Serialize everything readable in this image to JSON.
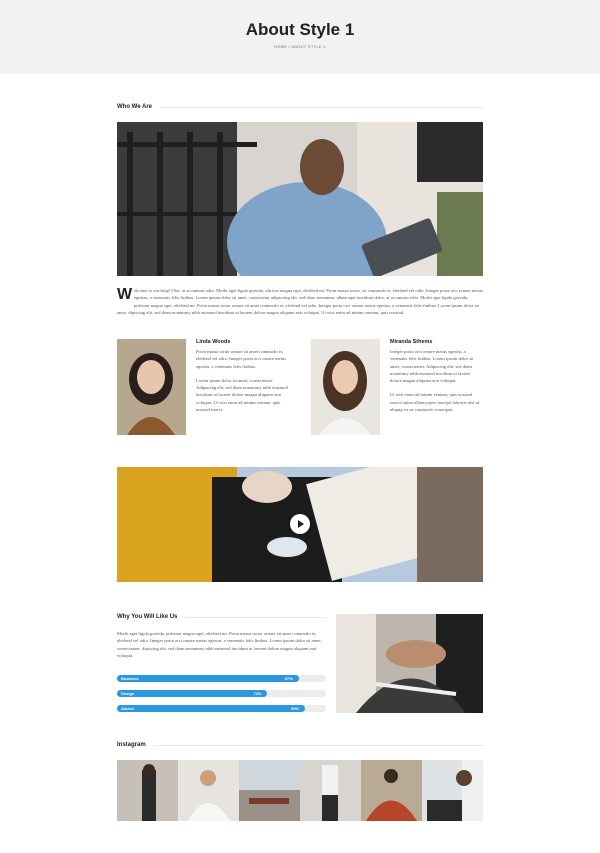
{
  "header": {
    "title": "About Style 1",
    "breadcrumb": "HOME / ABOUT STYLE 1"
  },
  "who_we_are": {
    "title": "Who We Are",
    "dropcap": "W",
    "intro": "elcome to our blog! Olor, at accumsan odio. Morbi eget ligula gravida, ultrices magna eget, eleifend mi. Proin massa tortor, sit commodo et, eleifend vel odio. Integer porta orci ornare metus egestas, a venenatis felis finibus. Lorem ipsum dolor sit amet, consectetur adipiscing elit, sed diam nonummy ullam eget tincidunt dolor, at accumsan odio. Morbi eget ligula gravida, pulvinar magna eget, eleifend mi. Proin massa tortor ornare sit amet commodo et, eleifend vel odio. Integer porta orci ornare metus egestas, a venenatis felis finibus. Lorem ipsum dolor sit amet, dipiscing elit, sed diam nonummy nibh euismod tincidunt ut laoreet dolore magna aliquam erat volutpat. Ut wisi enim ad minim veniam, quis nostrud."
  },
  "team": [
    {
      "name": "Linda Woods",
      "p1": "Proin massa tortor ornare sit amet commodo et, eleifend vel odio. Integer porta orci ornare metus egestas, a venenatis felis finibus.",
      "p2": "Lorem ipsum dolor sit amet, consectetuer. Adipiscing elit, sed diam nonummy nibh euismod tincidunt ut laoreet dolore magna aliquam erat volutpat. Ut wisi enim ad minim veniam, quis nostrud exerci."
    },
    {
      "name": "Miranda Sthems",
      "p1": "Integer porta orci ornare metus egestas, a venenatis felis finibus. Lorem ipsum dolor sit amet, consectetuer. Adipiscing elit, sed diam nonummy nibh euismod tincidunt ut laoreet dolore magna aliquam erat volutpat.",
      "p2": "Ut wisi enim ad minim veniam, quis nostrud exerci tation ullamcorper suscipit lobortis nisl ut aliquip ex ea commodo consequat."
    }
  ],
  "why": {
    "title": "Why You Will Like Us",
    "text": "Morbi eget ligula gravida, pulvinar magna eget, eleifend mi. Proin massa tortor ornare sit amet commodo et, eleifend vel odio. Integer porta orci ornare metus egestas, a venenatis felis finibus. Lorem ipsum dolor sit amet, consectetuer. dipiscing elit, sed diam nonummy nibh euismod tincidunt ut laoreet dolore magna aliquam erat volutpat.",
    "skills": [
      {
        "label": "Business",
        "value": 87,
        "pct": "87%"
      },
      {
        "label": "Design",
        "value": 72,
        "pct": "72%"
      },
      {
        "label": "Advice",
        "value": 90,
        "pct": "90%"
      }
    ]
  },
  "instagram": {
    "title": "Instagram"
  },
  "colors": {
    "accent": "#2a97e0",
    "hero_bg": "#f2f2f2"
  }
}
